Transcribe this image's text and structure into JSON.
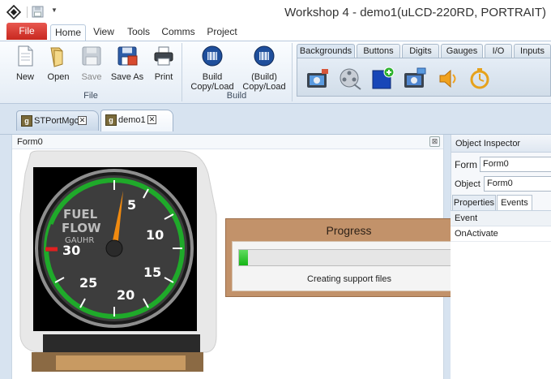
{
  "window": {
    "title": "Workshop 4 - demo1(uLCD-220RD, PORTRAIT)",
    "app_icon": "diamond-logo-icon",
    "quick_access": [
      "save-icon",
      "dropdown-arrow-icon"
    ]
  },
  "ribbon": {
    "file_tab": "File",
    "tabs": [
      {
        "label": "Home",
        "active": true
      },
      {
        "label": "View",
        "active": false
      },
      {
        "label": "Tools",
        "active": false
      },
      {
        "label": "Comms",
        "active": false
      },
      {
        "label": "Project",
        "active": false
      }
    ],
    "file_group": {
      "label": "File",
      "buttons": [
        {
          "label": "New",
          "icon": "new-document-icon",
          "enabled": true
        },
        {
          "label": "Open",
          "icon": "open-folder-icon",
          "enabled": true
        },
        {
          "label": "Save",
          "icon": "save-disk-icon",
          "enabled": false
        },
        {
          "label": "Save As",
          "icon": "save-as-icon",
          "enabled": true
        },
        {
          "label": "Print",
          "icon": "printer-icon",
          "enabled": true
        }
      ]
    },
    "build_group": {
      "label": "Build",
      "buttons": [
        {
          "label_line1": "Build",
          "label_line2": "Copy/Load",
          "icon": "build-chip-icon"
        },
        {
          "label_line1": "(Build)",
          "label_line2": "Copy/Load",
          "icon": "build-chip-icon"
        }
      ]
    },
    "widget_tabs": [
      {
        "label": "Backgrounds",
        "active": true
      },
      {
        "label": "Buttons",
        "active": false
      },
      {
        "label": "Digits",
        "active": false
      },
      {
        "label": "Gauges",
        "active": false
      },
      {
        "label": "I/O",
        "active": false
      },
      {
        "label": "Inputs",
        "active": false
      }
    ],
    "widget_icons": [
      "camera-image-icon",
      "film-reel-icon",
      "add-image-icon",
      "camera-image-alt-icon",
      "speaker-icon",
      "timer-icon"
    ]
  },
  "doc_tabs": [
    {
      "label": "STPortMgc",
      "active": false
    },
    {
      "label": "demo1",
      "active": true
    }
  ],
  "form": {
    "title": "Form0",
    "gauge": {
      "labels": [
        "FUEL",
        "FLOW",
        "GAUHR"
      ],
      "ticks": [
        "5",
        "10",
        "15",
        "20",
        "25",
        "30"
      ]
    }
  },
  "progress": {
    "title": "Progress",
    "value_fraction": 0.04,
    "status": "Creating support files"
  },
  "inspector": {
    "title": "Object Inspector",
    "form_label": "Form",
    "form_value": "Form0",
    "object_label": "Object",
    "object_value": "Form0",
    "tabs": [
      {
        "label": "Properties",
        "active": false
      },
      {
        "label": "Events",
        "active": true
      }
    ],
    "grid_header": "Event",
    "rows": [
      "OnActivate"
    ]
  },
  "colors": {
    "file_tab": "#d9372e",
    "progress_frame": "#c2926a",
    "progress_fill": "#22c022",
    "gauge_ring": "#1faa2a",
    "needle": "#f08a10"
  }
}
